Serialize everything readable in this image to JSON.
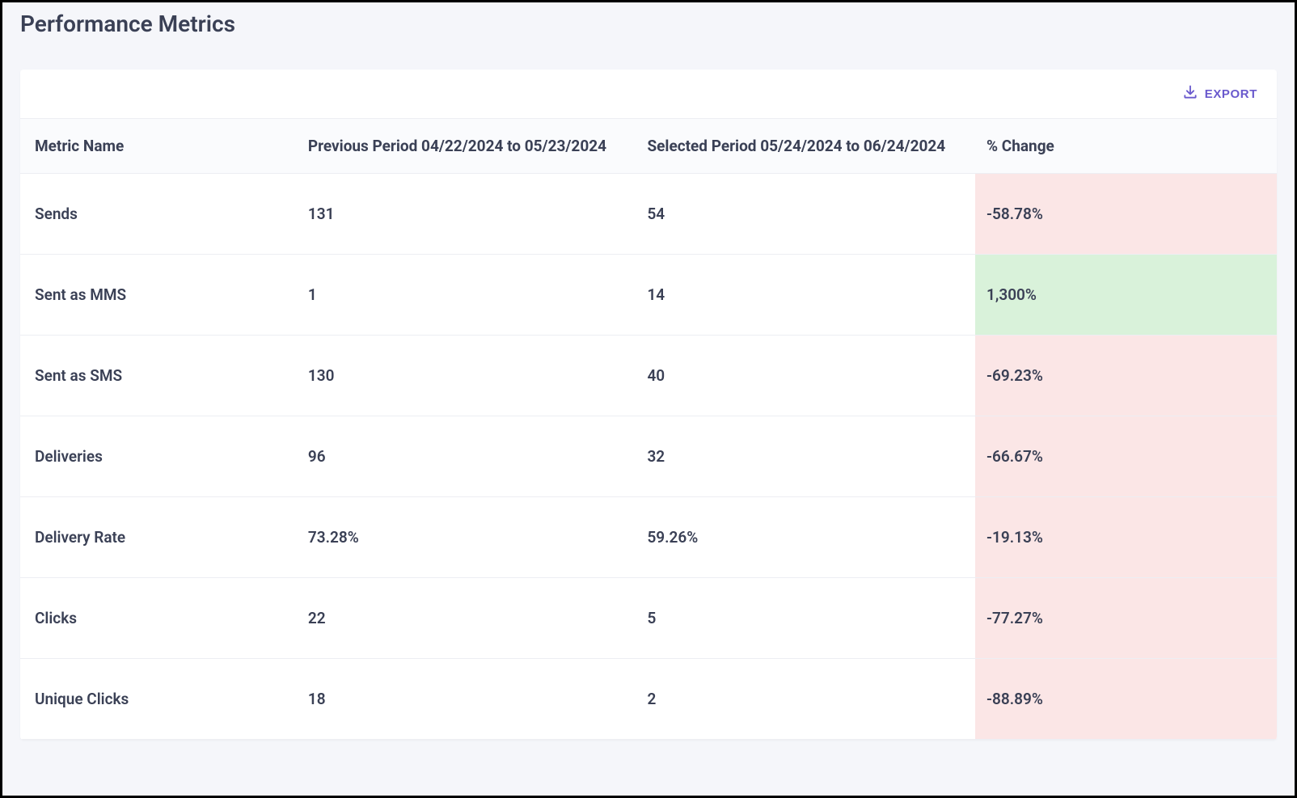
{
  "title": "Performance Metrics",
  "toolbar": {
    "export_label": "EXPORT"
  },
  "columns": {
    "metric": "Metric Name",
    "previous": "Previous Period 04/22/2024 to 05/23/2024",
    "selected": "Selected Period 05/24/2024 to 06/24/2024",
    "change": "% Change"
  },
  "rows": [
    {
      "metric": "Sends",
      "previous": "131",
      "selected": "54",
      "change": "-58.78%",
      "dir": "neg"
    },
    {
      "metric": "Sent as MMS",
      "previous": "1",
      "selected": "14",
      "change": "1,300%",
      "dir": "pos"
    },
    {
      "metric": "Sent as SMS",
      "previous": "130",
      "selected": "40",
      "change": "-69.23%",
      "dir": "neg"
    },
    {
      "metric": "Deliveries",
      "previous": "96",
      "selected": "32",
      "change": "-66.67%",
      "dir": "neg"
    },
    {
      "metric": "Delivery Rate",
      "previous": "73.28%",
      "selected": "59.26%",
      "change": "-19.13%",
      "dir": "neg"
    },
    {
      "metric": "Clicks",
      "previous": "22",
      "selected": "5",
      "change": "-77.27%",
      "dir": "neg"
    },
    {
      "metric": "Unique Clicks",
      "previous": "18",
      "selected": "2",
      "change": "-88.89%",
      "dir": "neg"
    }
  ]
}
